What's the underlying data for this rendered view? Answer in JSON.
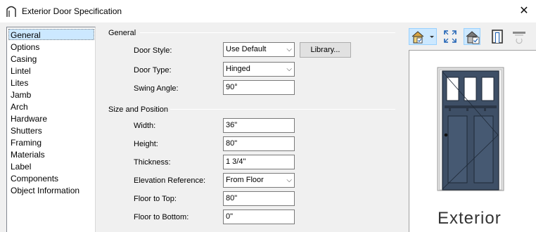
{
  "window": {
    "title": "Exterior Door Specification",
    "close_label": "✕"
  },
  "nav": {
    "items": [
      "General",
      "Options",
      "Casing",
      "Lintel",
      "Lites",
      "Jamb",
      "Arch",
      "Hardware",
      "Shutters",
      "Framing",
      "Materials",
      "Label",
      "Components",
      "Object Information"
    ],
    "selected": "General"
  },
  "general_group": {
    "title": "General",
    "door_style_label": "Door Style:",
    "door_style_value": "Use Default",
    "library_button": "Library...",
    "door_type_label": "Door Type:",
    "door_type_value": "Hinged",
    "swing_angle_label": "Swing Angle:",
    "swing_angle_value": "90°"
  },
  "size_group": {
    "title": "Size and Position",
    "width_label": "Width:",
    "width_value": "36\"",
    "height_label": "Height:",
    "height_value": "80\"",
    "thickness_label": "Thickness:",
    "thickness_value": "1 3/4\"",
    "elevation_label": "Elevation Reference:",
    "elevation_value": "From Floor",
    "floor_top_label": "Floor to Top:",
    "floor_top_value": "80\"",
    "floor_bottom_label": "Floor to Bottom:",
    "floor_bottom_value": "0\""
  },
  "preview": {
    "caption": "Exterior"
  },
  "colors": {
    "door_panel": "#3e4f66",
    "selection": "#cce8ff",
    "frame": "#e4e4e4"
  }
}
